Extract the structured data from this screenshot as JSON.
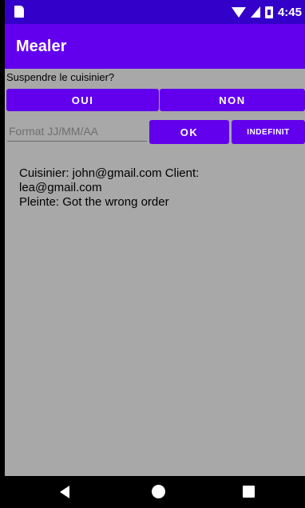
{
  "status_bar": {
    "time": "4:45"
  },
  "app_bar": {
    "title": "Mealer"
  },
  "suspend": {
    "question": "Suspendre le cuisinier?",
    "yes_label": "OUI",
    "no_label": "NON"
  },
  "date": {
    "placeholder": "Format JJ/MM/AA",
    "value": "",
    "ok_label": "OK",
    "indefinite_label": "INDEFINIT"
  },
  "complaint": {
    "line1": "Cuisinier: john@gmail.com Client:",
    "line2": "lea@gmail.com",
    "line3": "Pleinte: Got the wrong order"
  },
  "colors": {
    "status_bar": "#3300c9",
    "primary": "#6200ee",
    "background": "#a8a8a8"
  }
}
